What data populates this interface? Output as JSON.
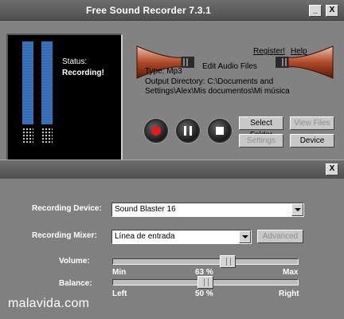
{
  "window": {
    "title": "Free Sound Recorder 7.3.1",
    "minimize_label": "_",
    "close_label": "X"
  },
  "display": {
    "status_label": "Status:",
    "status_value": "Recording!"
  },
  "header": {
    "register_link": "Register!",
    "help_link": "Help",
    "edit_label": "Edit Audio Files"
  },
  "info": {
    "type_line": "Type:    Mp3",
    "output_line1": "Output Directory:  C:\\Documents and",
    "output_line2": "Settings\\Alex\\Mis documentos\\Mi música"
  },
  "buttons": {
    "select_folder": "Select Folder",
    "view_files": "View Files",
    "settings": "Settings",
    "device": "Device"
  },
  "mixer_window": {
    "close_label": "X"
  },
  "mixer": {
    "recording_device_label": "Recording Device:",
    "recording_device_value": "Sound Blaster 16",
    "recording_mixer_label": "Recording Mixer:",
    "recording_mixer_value": "Línea  de entrada",
    "advanced_label": "Advanced",
    "volume_label": "Volume:",
    "volume_min": "Min",
    "volume_value": "63 %",
    "volume_max": "Max",
    "volume_level": 0.63,
    "balance_label": "Balance:",
    "balance_left": "Left",
    "balance_value": "50 %",
    "balance_right": "Right",
    "balance_level": 0.5
  },
  "watermark": "malavida.com",
  "colors": {
    "meter_blue": "#3a72b8",
    "record_red": "#e31b1b",
    "panel_gray": "#828282"
  },
  "icons": [
    "record-icon",
    "pause-icon",
    "stop-icon",
    "horn-left-icon",
    "horn-right-icon"
  ]
}
